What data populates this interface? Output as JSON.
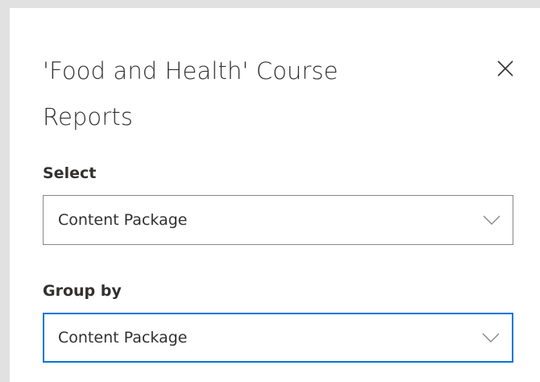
{
  "panel": {
    "title": "'Food and Health' Course Reports",
    "close_icon": "close-icon"
  },
  "select_field": {
    "label": "Select",
    "value": "Content Package",
    "icon": "chevron-down-icon"
  },
  "group_by_field": {
    "label": "Group by",
    "value": "Content Package",
    "icon": "chevron-down-icon",
    "focused": true
  },
  "colors": {
    "focus_border": "#0078d4",
    "border": "#8a8886",
    "text": "#323130",
    "backdrop": "#e1e1e1"
  }
}
